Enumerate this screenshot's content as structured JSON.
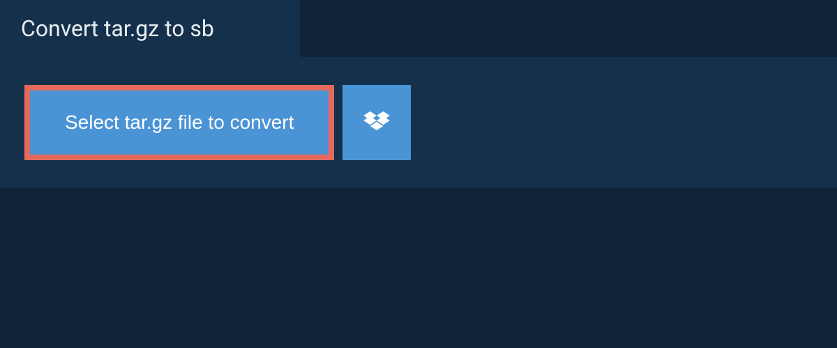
{
  "header": {
    "title": "Convert tar.gz to sb"
  },
  "actions": {
    "select_file_label": "Select tar.gz file to convert",
    "dropbox_icon": "dropbox"
  },
  "colors": {
    "background": "#0f2438",
    "panel": "#15304a",
    "button": "#4a94d6",
    "highlight_border": "#e36a5c",
    "text_light": "#e8eef3",
    "text_white": "#ffffff"
  }
}
